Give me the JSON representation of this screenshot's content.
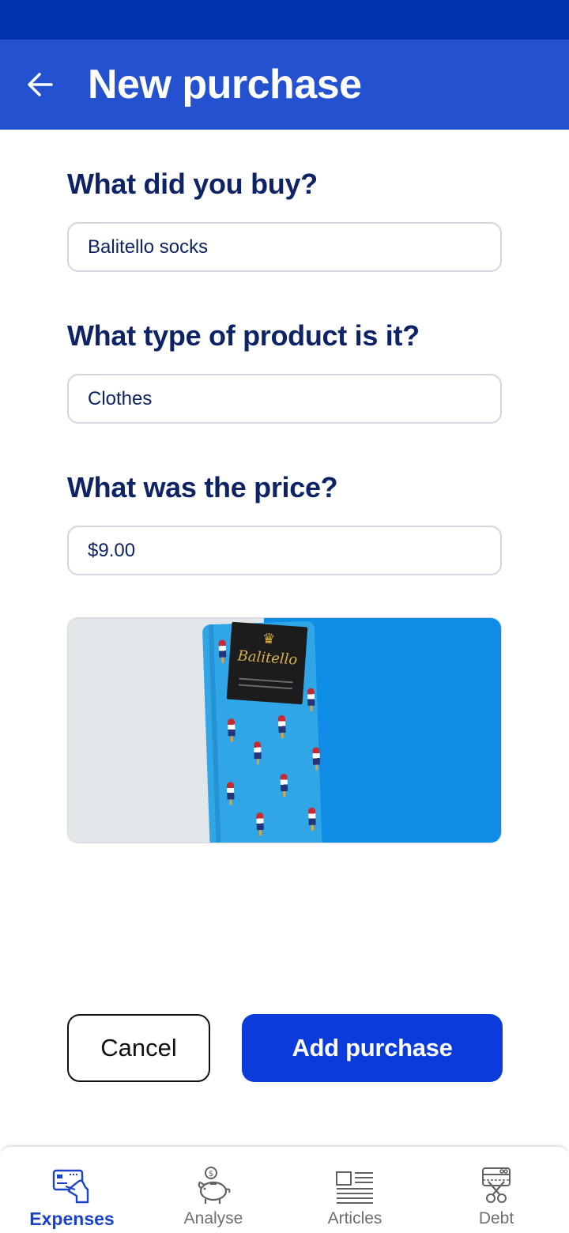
{
  "header": {
    "title": "New purchase"
  },
  "form": {
    "q_item": "What did you buy?",
    "item_value": "Balitello socks",
    "q_type": "What type of product is it?",
    "type_value": "Clothes",
    "q_price": "What was the price?",
    "price_value": "$9.00"
  },
  "photo": {
    "brand": "Balitello"
  },
  "actions": {
    "cancel_label": "Cancel",
    "add_label": "Add purchase"
  },
  "nav": {
    "items": [
      {
        "label": "Expenses",
        "icon": "credit-card-hand-icon",
        "active": true
      },
      {
        "label": "Analyse",
        "icon": "piggy-bank-icon",
        "active": false
      },
      {
        "label": "Articles",
        "icon": "newspaper-icon",
        "active": false
      },
      {
        "label": "Debt",
        "icon": "cut-card-icon",
        "active": false
      }
    ]
  },
  "colors": {
    "status_bar": "#0033b0",
    "app_bar": "#2451cf",
    "primary_button": "#0c3bdb",
    "heading_text": "#0e2266",
    "nav_active": "#1a42c8"
  }
}
